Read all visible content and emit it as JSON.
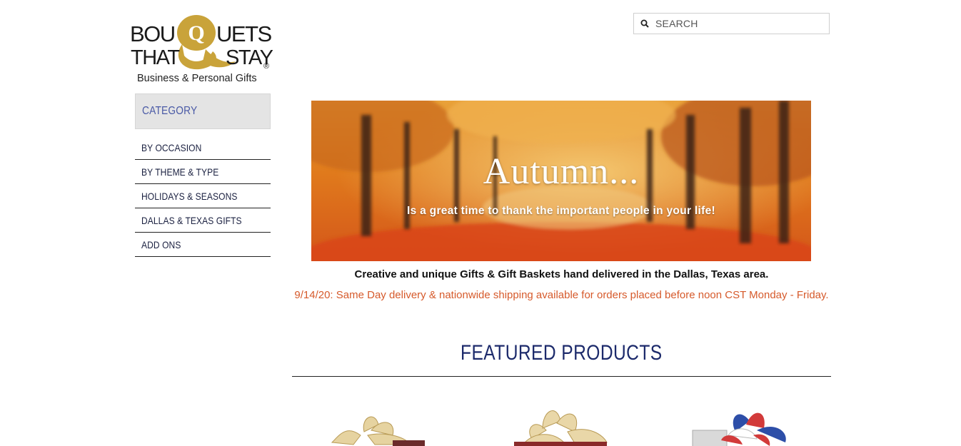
{
  "logo": {
    "line1": "BOUQUETS",
    "line2": "THAT STAY",
    "tagline": "Business & Personal Gifts"
  },
  "search": {
    "placeholder": "SEARCH"
  },
  "sidebar": {
    "header": "CATEGORY",
    "items": [
      {
        "label": "BY OCCASION"
      },
      {
        "label": "BY THEME & TYPE"
      },
      {
        "label": "HOLIDAYS & SEASONS"
      },
      {
        "label": "DALLAS & TEXAS GIFTS"
      },
      {
        "label": "ADD ONS"
      }
    ]
  },
  "banner": {
    "headline": "Autumn...",
    "subline": "Is a great time to thank the important people in your life!"
  },
  "intro": {
    "tagline": "Creative and unique Gifts & Gift Baskets hand delivered in the Dallas, Texas area.",
    "notice": "9/14/20: Same Day delivery & nationwide shipping available for orders placed before noon CST Monday - Friday."
  },
  "featured": {
    "title": "FEATURED PRODUCTS"
  },
  "colors": {
    "accent_navy": "#1c2a6b",
    "category_blue": "#4a5aa6",
    "notice_orange": "#d65a2b",
    "logo_gold": "#c9a33a"
  }
}
